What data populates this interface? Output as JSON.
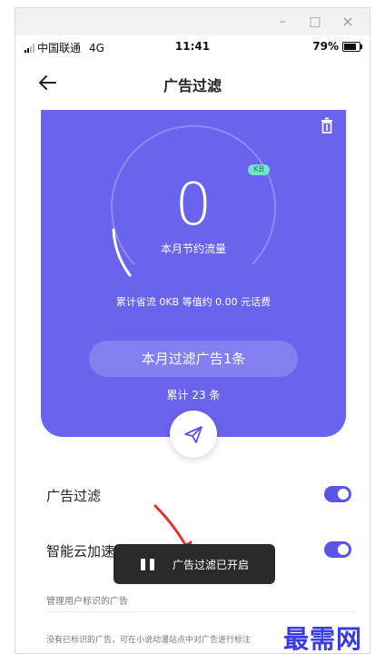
{
  "window": {
    "minimize": "–",
    "maximize": "□",
    "close": "×"
  },
  "status_bar": {
    "carrier": "中国联通",
    "network": "4G",
    "time": "11:41",
    "battery": "79%"
  },
  "nav": {
    "title": "广告过滤"
  },
  "card": {
    "kb_badge": "KB",
    "saved_value": "0",
    "gauge_label": "本月节约流量",
    "saved_summary": "累计省流 0KB 等值约 0.00 元话费",
    "monthly_filtered": "本月过滤广告1条",
    "total_filtered": "累计 23 条",
    "colors": {
      "card": "#6a63ee",
      "badge": "#6ee6c9"
    }
  },
  "settings": {
    "ad_filter_label": "广告过滤",
    "ad_filter_on": true,
    "cloud_accel_label": "智能云加速",
    "cloud_accel_on": true,
    "manage_hint": "管理用户标识的广告",
    "none_hint": "没有已标识的广告，可在小说动漫站点中对广告进行标注"
  },
  "toast": {
    "text": "广告过滤已开启"
  },
  "watermark": "最需网",
  "colors": {
    "accent": "#5b54e8",
    "toast": "#2a2a2a",
    "arrow": "#e53030"
  }
}
